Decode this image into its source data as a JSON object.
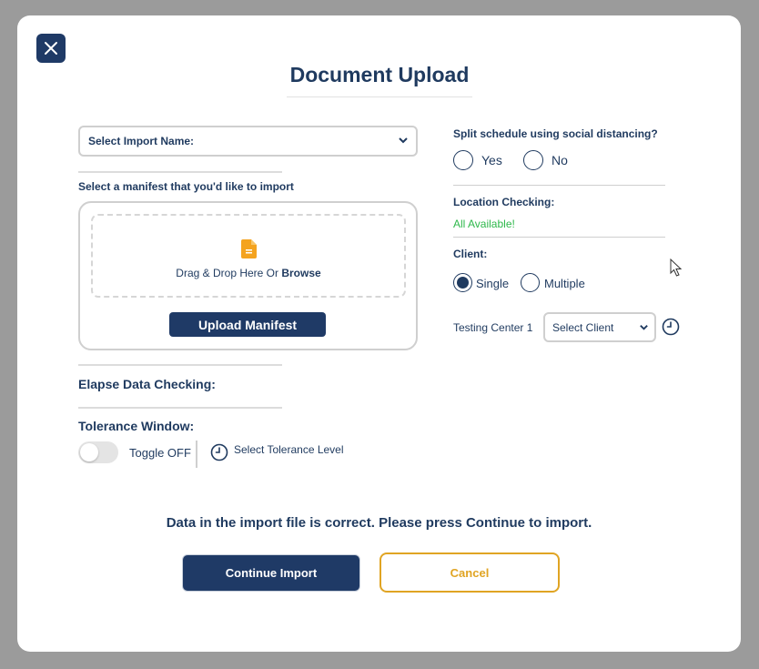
{
  "modal": {
    "title": "Document Upload",
    "close_icon": "close-icon"
  },
  "left": {
    "import_select": {
      "value": "Select Import Name:",
      "icon": "chevron-down-icon"
    },
    "manifest_prompt": "Select a manifest that you'd like to import",
    "drop_zone": {
      "text": "Drag & Drop Here Or",
      "browse": "Browse",
      "icon": "document-icon"
    },
    "upload_button": "Upload Manifest",
    "elapse_heading": "Elapse Data Checking:",
    "tolerance_heading": "Tolerance Window:",
    "toggle_label": "Toggle OFF",
    "toggle_on": false,
    "tolerance_level_label": "Select Tolerance Level",
    "tolerance_icon": "clock-icon"
  },
  "right": {
    "split_question": "Split schedule using social distancing?",
    "split_options": [
      {
        "label": "Yes",
        "checked": false
      },
      {
        "label": "No",
        "checked": false
      }
    ],
    "location_heading": "Location Checking:",
    "location_status": "All Available!",
    "client_heading": "Client:",
    "client_options": [
      {
        "label": "Single",
        "checked": true
      },
      {
        "label": "Multiple",
        "checked": false
      }
    ],
    "testing_center_label": "Testing Center 1",
    "client_select": {
      "value": "Select Client",
      "icon": "chevron-down-icon"
    },
    "testing_center_icon": "clock-icon"
  },
  "footer": {
    "message": "Data in the import file is correct. Please press Continue to import.",
    "continue_button": "Continue Import",
    "cancel_button": "Cancel"
  },
  "colors": {
    "primary": "#1f3a66",
    "text": "#1f3a5f",
    "success": "#2eb84b",
    "cancel": "#e0a423",
    "overlay": "#9b9b9b"
  }
}
